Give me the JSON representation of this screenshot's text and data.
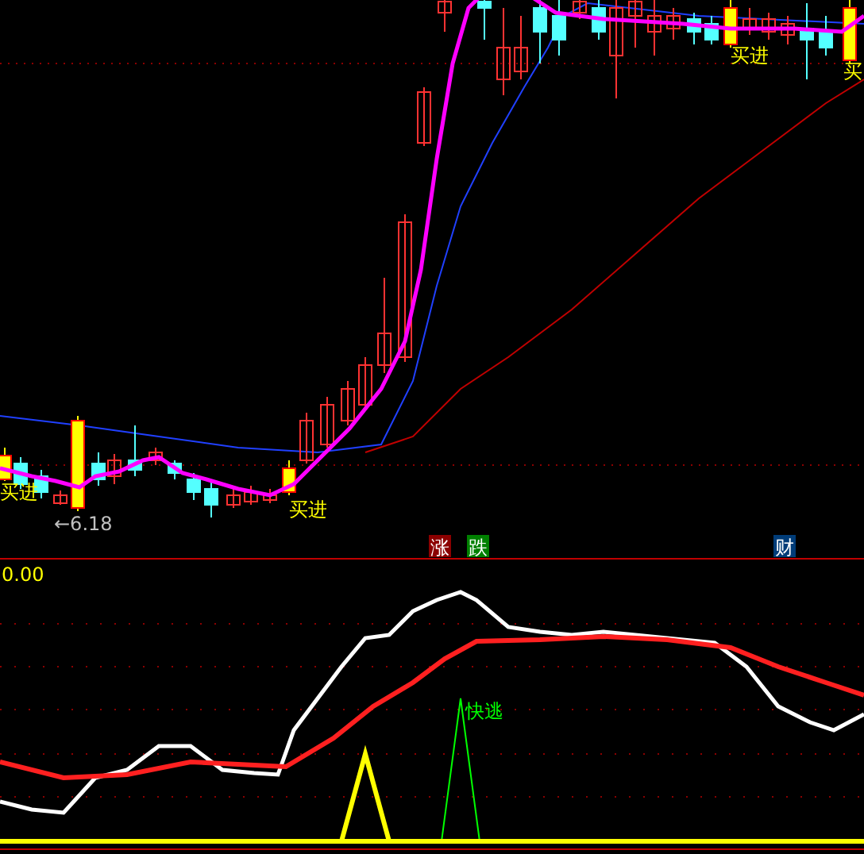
{
  "price_panel": {
    "buy_labels": [
      "买进",
      "买进",
      "买进",
      "买"
    ],
    "low_price_label": "←6.18"
  },
  "badges": [
    {
      "text": "涨",
      "color": "#8b0000"
    },
    {
      "text": "跌",
      "color": "#008000"
    },
    {
      "text": "财",
      "color": "#003c78"
    }
  ],
  "indicator_panel": {
    "value": "0.00",
    "signal_label": "快逃"
  }
}
